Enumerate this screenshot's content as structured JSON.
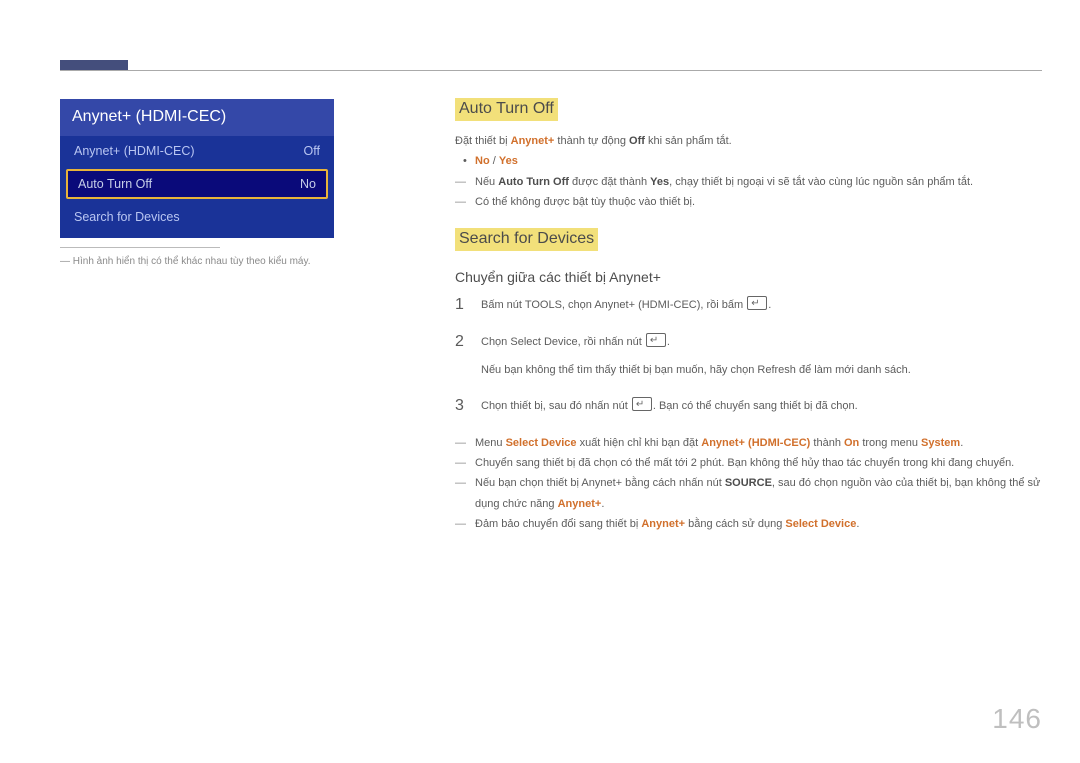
{
  "panel": {
    "title": "Anynet+ (HDMI-CEC)",
    "rows": [
      {
        "label": "Anynet+ (HDMI-CEC)",
        "value": "Off"
      },
      {
        "label": "Auto Turn Off",
        "value": "No"
      },
      {
        "label": "Search for Devices",
        "value": ""
      }
    ],
    "caption_prefix": "―",
    "caption": "Hình ảnh hiển thị có thể khác nhau tùy theo kiểu máy."
  },
  "sec1": {
    "heading": "Auto Turn Off",
    "intro_a": "Đặt thiết bị ",
    "intro_b": "Anynet+",
    "intro_c": " thành tự động ",
    "intro_d": "Off",
    "intro_e": " khi sản phẩm tắt.",
    "opt_no": "No",
    "opt_sep": " / ",
    "opt_yes": "Yes",
    "d1_a": "Nếu ",
    "d1_b": "Auto Turn Off",
    "d1_c": " được đặt thành ",
    "d1_d": "Yes",
    "d1_e": ", chạy thiết bị ngoại vi sẽ tắt vào cùng lúc nguồn sản phẩm tắt.",
    "d2": "Có thể không được bật tùy thuộc vào thiết bị."
  },
  "sec2": {
    "heading": "Search for Devices",
    "sub": "Chuyển giữa các thiết bị Anynet+",
    "s1_a": "Bấm nút ",
    "s1_b": "TOOLS",
    "s1_c": ", chọn ",
    "s1_d": "Anynet+ (HDMI-CEC)",
    "s1_e": ", rồi bấm ",
    "s1_f": ".",
    "s2_a": "Chọn ",
    "s2_b": "Select Device",
    "s2_c": ", rồi nhấn nút ",
    "s2_d": ".",
    "s2_note_a": "Nếu bạn không thể tìm thấy thiết bị bạn muốn, hãy chọn ",
    "s2_note_b": "Refresh",
    "s2_note_c": " để làm mới danh sách.",
    "s3_a": "Chọn thiết bị, sau đó nhấn nút ",
    "s3_b": ". Bạn có thể chuyển sang thiết bị đã chọn.",
    "n1_a": "Menu ",
    "n1_b": "Select Device",
    "n1_c": " xuất hiện chỉ khi bạn đặt ",
    "n1_d": "Anynet+ (HDMI-CEC)",
    "n1_e": " thành ",
    "n1_f": "On",
    "n1_g": " trong menu ",
    "n1_h": "System",
    "n1_i": ".",
    "n2": "Chuyển sang thiết bị đã chọn có thể mất tới 2 phút. Bạn không thể hủy thao tác chuyển trong khi đang chuyển.",
    "n3_a": "Nếu bạn chọn thiết bị Anynet+ bằng cách nhấn nút ",
    "n3_b": "SOURCE",
    "n3_c": ", sau đó chọn nguồn vào của thiết bị, bạn không thể sử dụng chức năng ",
    "n3_d": "Anynet+",
    "n3_e": ".",
    "n4_a": "Đảm bảo chuyển đổi sang thiết bị ",
    "n4_b": "Anynet+",
    "n4_c": " bằng cách sử dụng ",
    "n4_d": "Select Device",
    "n4_e": "."
  },
  "page": "146"
}
